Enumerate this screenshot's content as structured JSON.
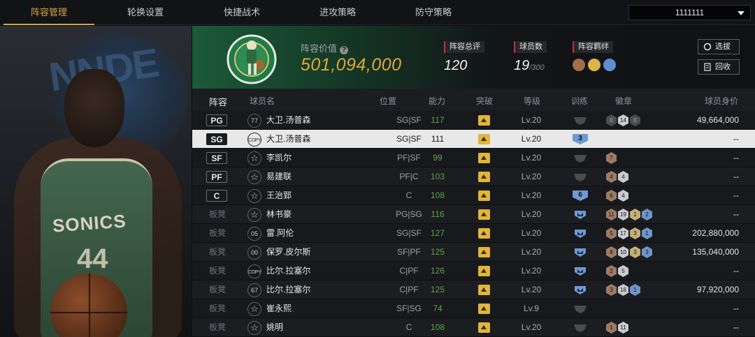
{
  "tabs": [
    "阵容管理",
    "轮换设置",
    "快捷战术",
    "进攻策略",
    "防守策略"
  ],
  "active_tab": 0,
  "account_dropdown": {
    "value": "1111111"
  },
  "team": {
    "value_label": "阵容价值",
    "value": "501,094,000",
    "rating_label": "阵容总评",
    "rating": "120",
    "players_label": "球员数",
    "players": "19",
    "players_max": "/300",
    "bond_label": "阵容羁绊",
    "btn_scout": "选拔",
    "btn_recycle": "回收"
  },
  "table": {
    "headers": [
      "阵容",
      "球员名",
      "位置",
      "能力",
      "突破",
      "等级",
      "训练",
      "徽章",
      "球员身价"
    ],
    "rows": [
      {
        "slot": "PG",
        "num": "77",
        "name": "大卫.汤普森",
        "pos": "SG|SF",
        "ability": "117",
        "level": "Lv.20",
        "train": "0",
        "badges": [
          [
            "dark",
            "0"
          ],
          [
            "silver",
            "14"
          ],
          [
            "dark",
            "0"
          ]
        ],
        "salary": "49,664,000"
      },
      {
        "slot": "SG",
        "num": "COPY",
        "name": "大卫.汤普森",
        "pos": "SG|SF",
        "ability": "111",
        "level": "Lv.20",
        "train": "3",
        "badges": [],
        "salary": "--",
        "selected": true
      },
      {
        "slot": "SF",
        "num": "☆",
        "name": "李凯尔",
        "pos": "PF|SF",
        "ability": "99",
        "level": "Lv.20",
        "train": "0",
        "badges": [
          [
            "bronze",
            "7"
          ]
        ],
        "salary": "--"
      },
      {
        "slot": "PF",
        "num": "☆",
        "name": "易建联",
        "pos": "PF|C",
        "ability": "103",
        "level": "Lv.20",
        "train": "0",
        "badges": [
          [
            "bronze",
            "4"
          ],
          [
            "silver",
            "4"
          ]
        ],
        "salary": "--"
      },
      {
        "slot": "C",
        "num": "☆",
        "name": "王治郅",
        "pos": "C",
        "ability": "108",
        "level": "Lv.20",
        "train": "6",
        "badges": [
          [
            "bronze",
            "6"
          ],
          [
            "silver",
            "4"
          ]
        ],
        "salary": "--"
      },
      {
        "slot": "板凳",
        "num": "☆",
        "name": "林书豪",
        "pos": "PG|SG",
        "ability": "116",
        "level": "Lv.20",
        "train": "crown",
        "badges": [
          [
            "bronze",
            "11"
          ],
          [
            "silver",
            "19"
          ],
          [
            "gold",
            "1"
          ],
          [
            "blue",
            "2"
          ]
        ],
        "salary": "--"
      },
      {
        "slot": "板凳",
        "num": "05",
        "name": "雷.阿伦",
        "pos": "SG|SF",
        "ability": "127",
        "level": "Lv.20",
        "train": "crown",
        "badges": [
          [
            "bronze",
            "5"
          ],
          [
            "silver",
            "17"
          ],
          [
            "gold",
            "3"
          ],
          [
            "blue",
            "1"
          ]
        ],
        "salary": "202,880,000"
      },
      {
        "slot": "板凳",
        "num": "00",
        "name": "保罗.皮尔斯",
        "pos": "SF|PF",
        "ability": "125",
        "level": "Lv.20",
        "train": "crown",
        "badges": [
          [
            "bronze",
            "8"
          ],
          [
            "silver",
            "10"
          ],
          [
            "gold",
            "3"
          ],
          [
            "blue",
            "3"
          ]
        ],
        "salary": "135,040,000"
      },
      {
        "slot": "板凳",
        "num": "COPY",
        "name": "比尔.拉塞尔",
        "pos": "C|PF",
        "ability": "126",
        "level": "Lv.20",
        "train": "crown",
        "badges": [
          [
            "bronze",
            "2"
          ],
          [
            "silver",
            "5"
          ]
        ],
        "salary": "--"
      },
      {
        "slot": "板凳",
        "num": "67",
        "name": "比尔.拉塞尔",
        "pos": "C|PF",
        "ability": "125",
        "level": "Lv.20",
        "train": "crown",
        "badges": [
          [
            "bronze",
            "3"
          ],
          [
            "silver",
            "16"
          ],
          [
            "blue",
            "1"
          ]
        ],
        "salary": "97,920,000"
      },
      {
        "slot": "板凳",
        "num": "☆",
        "name": "崔永熙",
        "pos": "SF|SG",
        "ability": "74",
        "level": "Lv.9",
        "train": "0",
        "badges": [],
        "salary": "--"
      },
      {
        "slot": "板凳",
        "num": "☆",
        "name": "姚明",
        "pos": "C",
        "ability": "108",
        "level": "Lv.20",
        "train": "0",
        "badges": [
          [
            "bronze",
            "1"
          ],
          [
            "silver",
            "11"
          ]
        ],
        "salary": "--"
      }
    ]
  },
  "colors": {
    "accent": "#d9a63a",
    "value": "#e1a73c",
    "ability": "#5aa64a",
    "team_green": "#1b5a38"
  },
  "art": {
    "jersey_text": "SONICS",
    "jersey_num": "44",
    "logo_text": "NNDE"
  }
}
